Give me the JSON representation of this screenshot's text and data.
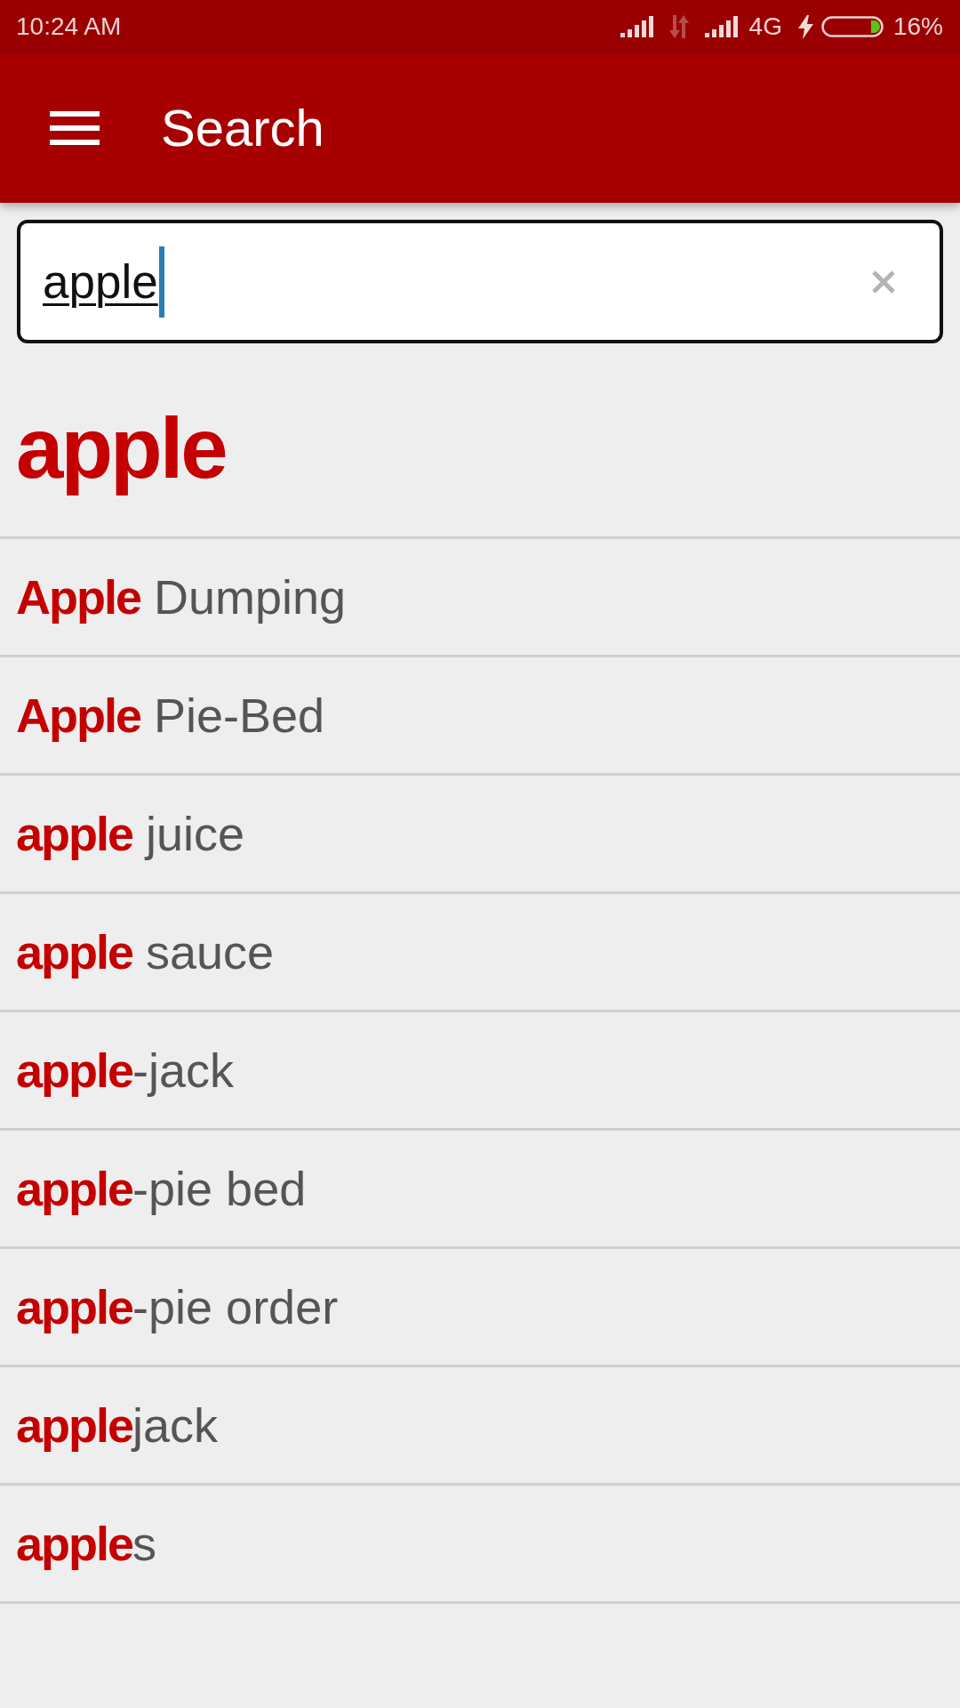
{
  "status_bar": {
    "time": "10:24 AM",
    "network": "4G",
    "battery": "16%"
  },
  "app_bar": {
    "title": "Search"
  },
  "search": {
    "value": "apple",
    "composing": true,
    "focused": true
  },
  "heading": "apple",
  "results": [
    "**Apple** Dumping",
    "**Apple** Pie-Bed",
    "**apple** juice",
    "**apple** sauce",
    "**apple**-jack",
    "**apple**-pie bed",
    "**apple**-pie order",
    "**apple**jack",
    "**apple**s"
  ]
}
